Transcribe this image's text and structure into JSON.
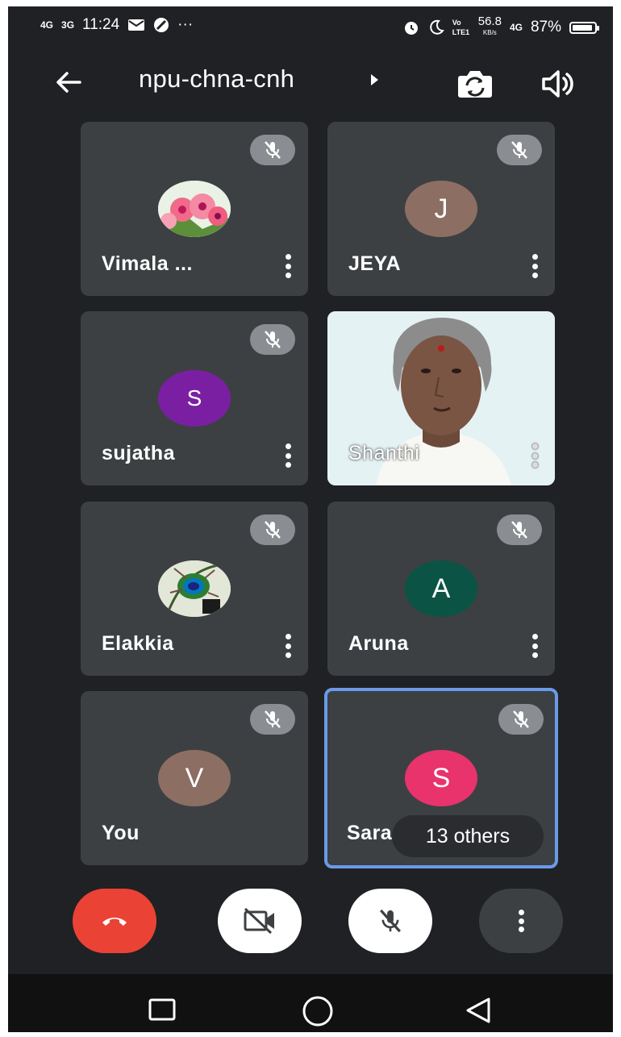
{
  "status_bar": {
    "signal_1": "4G",
    "signal_2": "3G",
    "time": "11:24",
    "more": "···",
    "volte": "Vo LTE1",
    "speed_value": "56.8",
    "speed_unit": "KB/s",
    "signal_3": "4G",
    "battery_percent": "87%",
    "icons": [
      "mail-icon",
      "app-icon",
      "alarm-icon",
      "moon-icon",
      "battery-icon"
    ]
  },
  "header": {
    "meeting_title": "npu-chna-cnh",
    "icons": [
      "back-arrow-icon",
      "caret-right-icon",
      "switch-camera-icon",
      "speaker-icon"
    ]
  },
  "participants": [
    {
      "name": "Vimala ...",
      "avatar_type": "photo-flowers",
      "muted": true
    },
    {
      "name": "JEYA",
      "initial": "J",
      "avatar_color": "#8d6e63",
      "muted": true
    },
    {
      "name": "sujatha",
      "initial": "S",
      "avatar_color": "#7b1fa2",
      "muted": true
    },
    {
      "name": "Shanthi",
      "avatar_type": "live-video",
      "muted": false
    },
    {
      "name": "Elakkia",
      "avatar_type": "photo-peacock",
      "muted": true
    },
    {
      "name": "Aruna",
      "initial": "A",
      "avatar_color": "#0b5345",
      "muted": true
    },
    {
      "name": "You",
      "initial": "V",
      "avatar_color": "#8d6e63",
      "muted": true
    },
    {
      "name": "Sara",
      "initial": "S",
      "avatar_color": "#e8336d",
      "muted": true,
      "overflow_label": "13 others",
      "highlighted": true
    }
  ],
  "controls": {
    "end_call_color": "#ea4335",
    "icons": [
      "end-call-icon",
      "camera-off-icon",
      "mic-off-icon",
      "more-options-icon"
    ]
  },
  "nav_bar": {
    "icons": [
      "recents-square-icon",
      "home-circle-icon",
      "back-triangle-icon"
    ]
  }
}
